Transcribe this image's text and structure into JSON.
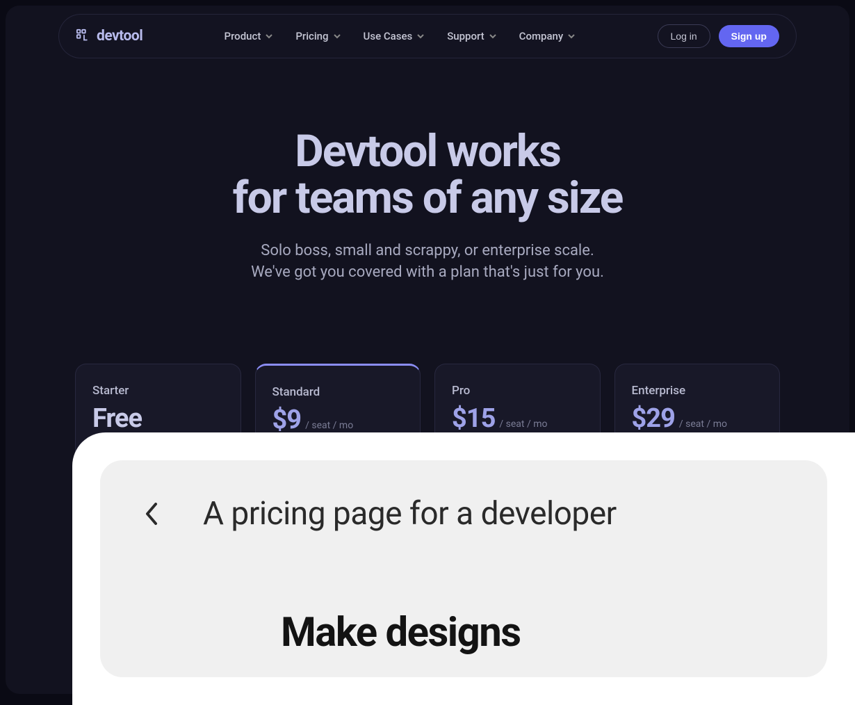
{
  "header": {
    "logo_text": "devtool",
    "nav": [
      {
        "label": "Product"
      },
      {
        "label": "Pricing"
      },
      {
        "label": "Use Cases"
      },
      {
        "label": "Support"
      },
      {
        "label": "Company"
      }
    ],
    "login_label": "Log in",
    "signup_label": "Sign up"
  },
  "hero": {
    "title_line1": "Devtool works",
    "title_line2": "for teams of any size",
    "subtitle_line1": "Solo boss, small and scrappy, or enterprise scale.",
    "subtitle_line2": "We've got you covered with a plan that's just for you."
  },
  "pricing": {
    "plans": [
      {
        "name": "Starter",
        "price": "Free",
        "unit": "",
        "highlighted": false
      },
      {
        "name": "Standard",
        "price": "$9",
        "unit": "/ seat / mo",
        "highlighted": true
      },
      {
        "name": "Pro",
        "price": "$15",
        "unit": "/ seat / mo",
        "highlighted": false
      },
      {
        "name": "Enterprise",
        "price": "$29",
        "unit": "/ seat / mo",
        "highlighted": false
      }
    ]
  },
  "overlay": {
    "breadcrumb_title": "A pricing page for a developer",
    "heading": "Make designs"
  }
}
